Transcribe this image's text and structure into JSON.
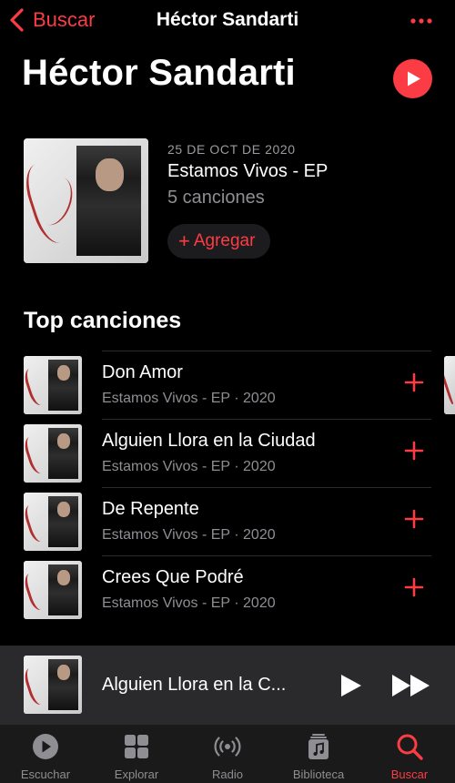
{
  "nav": {
    "back_label": "Buscar",
    "title": "Héctor Sandarti"
  },
  "header": {
    "artist_name": "Héctor Sandarti"
  },
  "latest_release": {
    "date": "25 DE OCT DE 2020",
    "title": "Estamos Vivos - EP",
    "count": "5 canciones",
    "add_label": "Agregar"
  },
  "top_songs": {
    "title": "Top canciones",
    "items": [
      {
        "name": "Don Amor",
        "subtitle": "Estamos Vivos - EP · 2020"
      },
      {
        "name": "Alguien Llora en la Ciudad",
        "subtitle": "Estamos Vivos - EP · 2020"
      },
      {
        "name": "De Repente",
        "subtitle": "Estamos Vivos - EP · 2020"
      },
      {
        "name": "Crees Que Podré",
        "subtitle": "Estamos Vivos - EP · 2020"
      }
    ]
  },
  "mini_player": {
    "title": "Alguien Llora en la C..."
  },
  "tabs": [
    {
      "label": "Escuchar",
      "icon": "play-circle-icon"
    },
    {
      "label": "Explorar",
      "icon": "grid-icon"
    },
    {
      "label": "Radio",
      "icon": "radio-icon"
    },
    {
      "label": "Biblioteca",
      "icon": "library-icon"
    },
    {
      "label": "Buscar",
      "icon": "search-icon",
      "active": true
    }
  ],
  "colors": {
    "accent": "#fc3c44",
    "background": "#000000",
    "secondary_text": "#8e8e93",
    "mini_player_bg": "#2a2a2c"
  }
}
